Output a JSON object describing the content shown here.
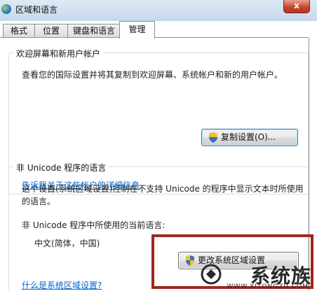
{
  "window": {
    "title": "区域和语言",
    "close_label": "x"
  },
  "tabs": [
    {
      "label": "格式"
    },
    {
      "label": "位置"
    },
    {
      "label": "键盘和语言"
    },
    {
      "label": "管理"
    }
  ],
  "welcome_group": {
    "legend": "欢迎屏幕和新用户帐户",
    "description": "查看您的国际设置并将其复制到欢迎屏幕、系统帐户和新的用户帐户。",
    "copy_button": "复制设置(O)...",
    "details_link": "告诉我关于这些帐户的详细信息"
  },
  "unicode_group": {
    "legend": "非 Unicode 程序的语言",
    "description_line1": "这个设置(系统区域设置)控制在不支持 Unicode 的程序中显示文本时所使用",
    "description_line2": "的语言。",
    "current_label": "非 Unicode 程序中所使用的当前语言:",
    "current_value": "中文(简体，中国)",
    "change_button": "更改系统区域设置",
    "help_link": "什么是系统区域设置?"
  },
  "watermark": {
    "brand": "系统族",
    "url": "WWW.XITONGZU.COM"
  },
  "colors": {
    "link": "#0066cc",
    "highlight_border": "#a0261f",
    "tab_border": "#8e8f8f"
  }
}
